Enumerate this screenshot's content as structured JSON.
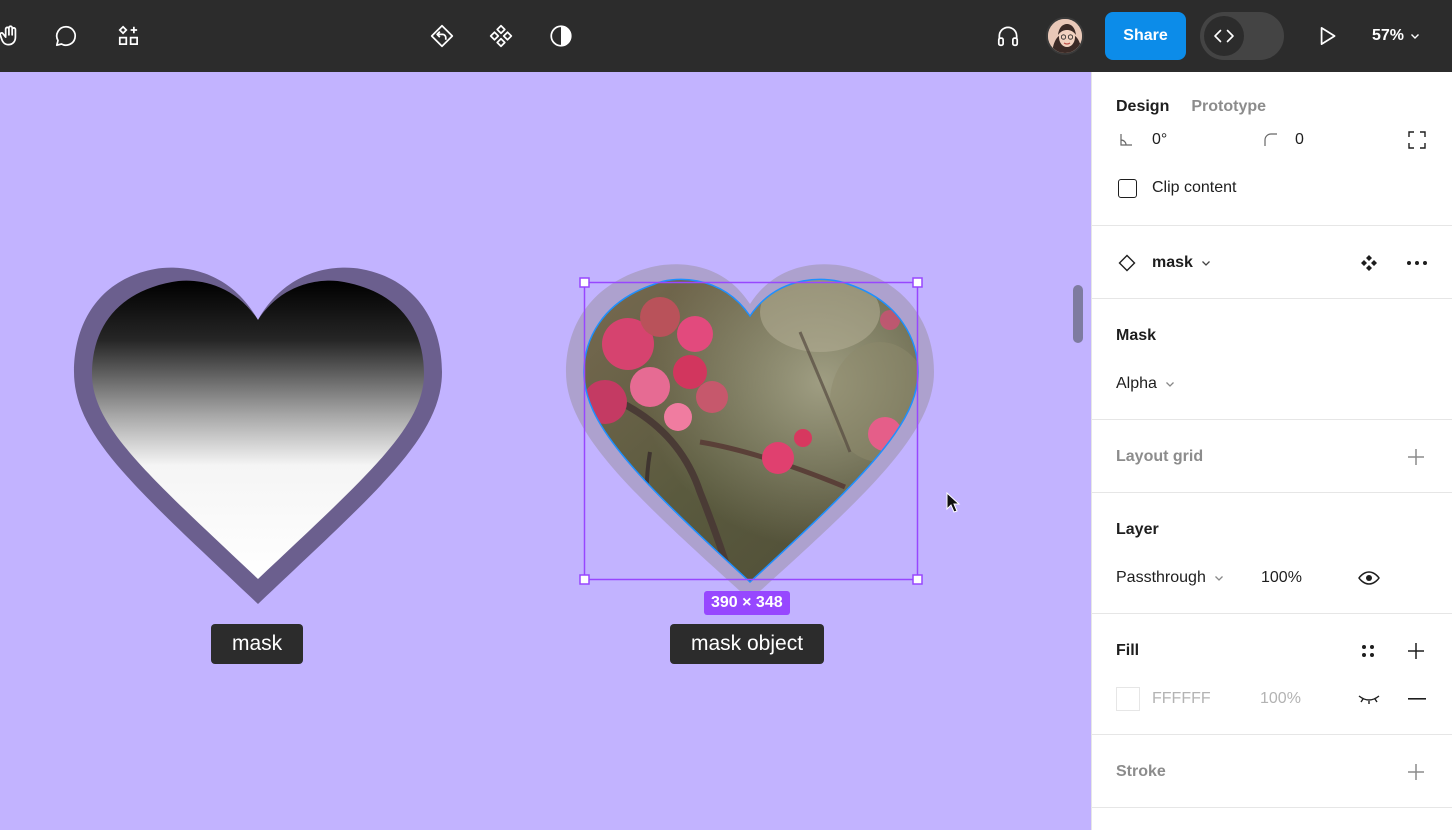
{
  "toolbar": {
    "left_tools": [
      "hand-tool",
      "comment-tool",
      "actions-tool"
    ],
    "center_tools": [
      "reset-instance",
      "components",
      "contrast"
    ],
    "share_label": "Share",
    "zoom_label": "57%"
  },
  "canvas": {
    "background": "#c2b3ff",
    "mask_label": "mask",
    "mask_object_label": "mask object",
    "dimension_badge": "390 × 348"
  },
  "panel": {
    "tabs": [
      {
        "label": "Design",
        "active": true
      },
      {
        "label": "Prototype",
        "active": false
      }
    ],
    "rotation_value": "0°",
    "radius_value": "0",
    "clip_content_label": "Clip content",
    "component": {
      "name": "mask"
    },
    "mask": {
      "title": "Mask",
      "type": "Alpha"
    },
    "layout_grid": {
      "title": "Layout grid"
    },
    "layer": {
      "title": "Layer",
      "blend": "Passthrough",
      "opacity": "100%"
    },
    "fill": {
      "title": "Fill",
      "hex": "FFFFFF",
      "opacity": "100%"
    },
    "stroke": {
      "title": "Stroke"
    }
  },
  "colors": {
    "accent": "#0c8ce9",
    "selection": "#9747ff",
    "toolbar_bg": "#2c2c2c"
  }
}
